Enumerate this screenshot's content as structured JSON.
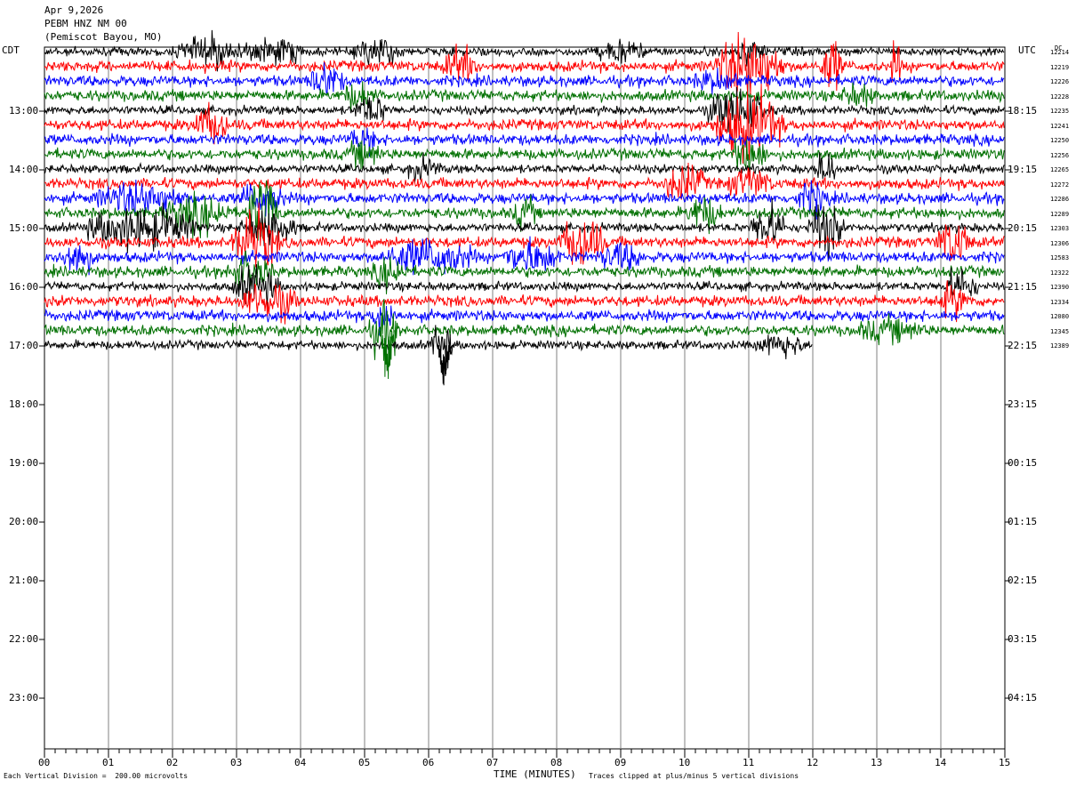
{
  "header": {
    "date": "Apr 9,2026",
    "station": "PEBM HNZ NM 00",
    "location": "(Pemiscot Bayou, MO)"
  },
  "axes": {
    "left_title": "CDT",
    "right_title": "UTC",
    "dc_title": "DC",
    "x_title": "TIME (MINUTES)"
  },
  "footer": {
    "note_left": "Each Vertical Division =  200.00 microvolts",
    "note_right": "Traces clipped at plus/minus 5 vertical divisions"
  },
  "chart_data": {
    "type": "line",
    "title": "PEBM HNZ NM 00 (Pemiscot Bayou, MO)",
    "xlabel": "TIME (MINUTES)",
    "xlim": [
      0,
      15
    ],
    "x_ticks": [
      "00",
      "01",
      "02",
      "03",
      "04",
      "05",
      "06",
      "07",
      "08",
      "09",
      "10",
      "11",
      "12",
      "13",
      "14",
      "15"
    ],
    "left_hour_labels": [
      "13:00",
      "14:00",
      "15:00",
      "16:00",
      "17:00",
      "18:00",
      "19:00",
      "20:00",
      "21:00",
      "22:00",
      "23:00"
    ],
    "right_hour_labels": [
      "18:15",
      "19:15",
      "20:15",
      "21:15",
      "22:15",
      "23:15",
      "00:15",
      "01:15",
      "02:15",
      "03:15",
      "04:15"
    ],
    "trace_colors": [
      "#000000",
      "#ff0000",
      "#0000ff",
      "#007000"
    ],
    "dc_offsets": [
      "12214",
      "12219",
      "12226",
      "12228",
      "12235",
      "12241",
      "12250",
      "12256",
      "12265",
      "12272",
      "12286",
      "12289",
      "12303",
      "12306",
      "12583",
      "12322",
      "12390",
      "12334",
      "12080",
      "12345",
      "12389"
    ],
    "traces_start": "12:15 CDT",
    "traces_end_minute": 12.0,
    "vertical_division_microvolts": 200.0,
    "clip_divisions": 5
  }
}
